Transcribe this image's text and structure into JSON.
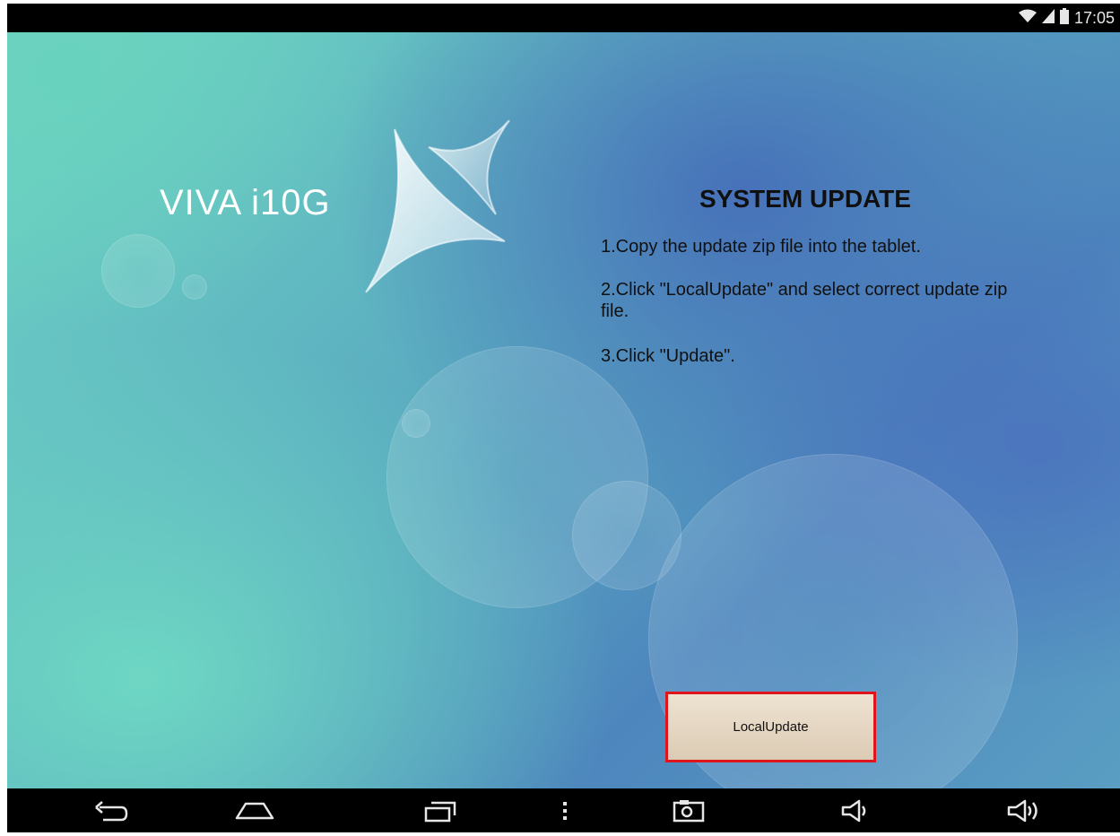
{
  "status_bar": {
    "time": "17:05",
    "icons": [
      "wifi-icon",
      "signal-icon",
      "battery-icon"
    ]
  },
  "logo": {
    "text": "VIVA i10G",
    "mark": "star-logo-icon"
  },
  "update_panel": {
    "title": "SYSTEM UPDATE",
    "steps": [
      "1.Copy the update zip file into the tablet.",
      "2.Click \"LocalUpdate\" and select correct update zip file.",
      "3.Click \"Update\"."
    ]
  },
  "actions": {
    "local_update_label": "LocalUpdate"
  },
  "nav_bar": {
    "buttons": [
      "back-icon",
      "home-icon",
      "recent-apps-icon",
      "menu-icon",
      "screenshot-icon",
      "volume-down-icon",
      "volume-up-icon"
    ]
  },
  "colors": {
    "highlight_border": "#e0141b",
    "button_fill": "#e6d8c4",
    "bar_background": "#000000"
  }
}
